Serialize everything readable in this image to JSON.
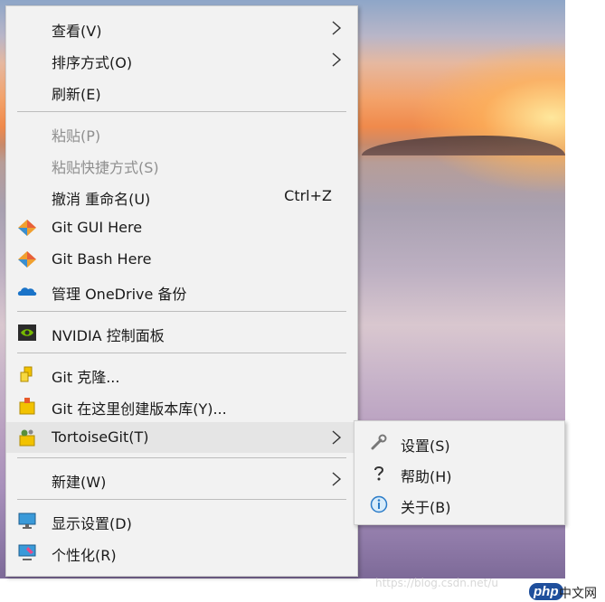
{
  "menu": {
    "items": [
      {
        "label": "查看(V)"
      },
      {
        "label": "排序方式(O)"
      },
      {
        "label": "刷新(E)"
      },
      {
        "label": "粘贴(P)"
      },
      {
        "label": "粘贴快捷方式(S)"
      },
      {
        "label": "撤消 重命名(U)",
        "shortcut": "Ctrl+Z"
      },
      {
        "label": "Git GUI Here",
        "icon": "git-diamond-icon"
      },
      {
        "label": "Git Bash Here",
        "icon": "git-diamond-icon"
      },
      {
        "label": "管理 OneDrive 备份",
        "icon": "onedrive-cloud-icon"
      },
      {
        "label": "NVIDIA 控制面板",
        "icon": "nvidia-icon"
      },
      {
        "label": "Git 克隆...",
        "icon": "git-clone-icon"
      },
      {
        "label": "Git 在这里创建版本库(Y)...",
        "icon": "git-create-repo-icon"
      },
      {
        "label": "TortoiseGit(T)",
        "icon": "tortoisegit-icon"
      },
      {
        "label": "新建(W)"
      },
      {
        "label": "显示设置(D)",
        "icon": "display-settings-icon"
      },
      {
        "label": "个性化(R)",
        "icon": "personalize-icon"
      }
    ]
  },
  "submenu": {
    "items": [
      {
        "label": "设置(S)",
        "icon": "wrench-icon"
      },
      {
        "label": "帮助(H)",
        "icon": "help-icon"
      },
      {
        "label": "关于(B)",
        "icon": "info-icon"
      }
    ]
  },
  "watermark": {
    "text": "https://blog.csdn.net/u",
    "logo": "php",
    "logo_cn": "中文网"
  },
  "colors": {
    "menu_background": "#f2f2f2",
    "hover_background": "#e5e5e5",
    "disabled_text": "#8f8f8f",
    "separator": "#bdbdbd"
  }
}
